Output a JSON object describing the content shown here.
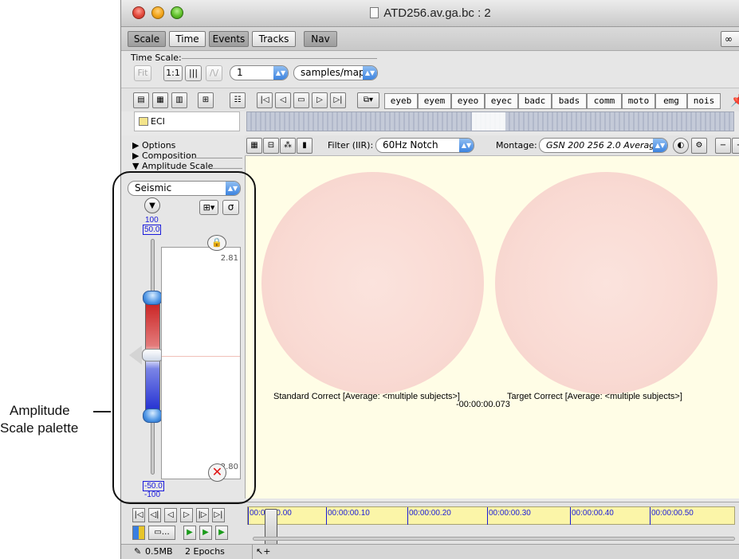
{
  "callout": {
    "line1": "Amplitude",
    "line2": "Scale palette"
  },
  "window": {
    "title": "ATD256.av.ga.bc : 2"
  },
  "tabs": [
    {
      "label": "Scale",
      "on": true
    },
    {
      "label": "Time",
      "on": false
    },
    {
      "label": "Events",
      "on": true
    },
    {
      "label": "Tracks",
      "on": false
    },
    {
      "label": "Nav",
      "on": true
    }
  ],
  "link_icon": "link-icon",
  "timescale": {
    "label": "Time Scale:",
    "fit_label": "Fit",
    "one_to_one_label": "1:1",
    "value": "1",
    "unit": "samples/map"
  },
  "event_tags": [
    "eyeb",
    "eyem",
    "eyeo",
    "eyec",
    "badc",
    "bads",
    "comm",
    "moto",
    "emg",
    "nois"
  ],
  "eci_label": "ECI",
  "panel": {
    "options": "Options",
    "composition": "Composition",
    "amplitude_scale": "Amplitude Scale",
    "scale_type": "Seismic",
    "top_value": "100",
    "top_box": "50.0",
    "trace_max": "2.81",
    "trace_min": "-2.80",
    "bottom_box": "-50.0",
    "bottom_value": "-100",
    "sigma": "σ"
  },
  "map_toolbar": {
    "filter_label": "Filter (IIR):",
    "filter_value": "60Hz Notch",
    "montage_label": "Montage:",
    "montage_value": "GSN 200 256 2.0 Averag..."
  },
  "maps": {
    "left_caption": "Standard Correct [Average: <multiple subjects>]",
    "right_caption": "Target Correct [Average: <multiple subjects>]",
    "time": "-00:00:00.073",
    "head_color": "#f9dad3",
    "background": "#fffde6"
  },
  "timeline": {
    "labels": [
      "00:00:00.00",
      "00:00:00.10",
      "00:00:00.20",
      "00:00:00.30",
      "00:00:00.40",
      "00:00:00.50"
    ]
  },
  "status": {
    "memory": "0.5MB",
    "epochs": "2 Epochs"
  }
}
